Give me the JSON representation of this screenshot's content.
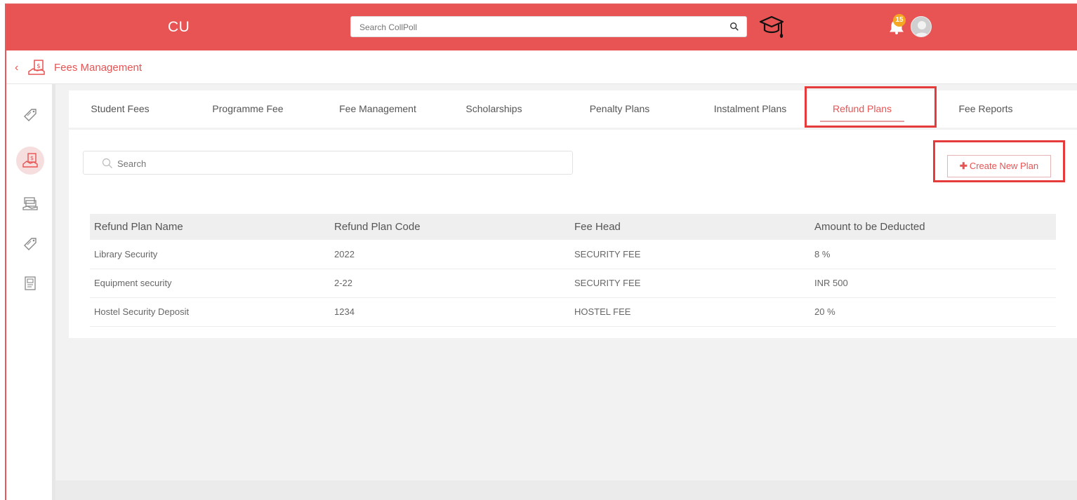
{
  "app": {
    "brand": "CU",
    "search_placeholder": "Search CollPoll",
    "notification_count": "15",
    "colors": {
      "primary": "#e85353",
      "highlight": "#e53b3b"
    }
  },
  "breadcrumb": {
    "title": "Fees Management"
  },
  "sidebar": {
    "items": [
      {
        "icon": "tag-icon"
      },
      {
        "icon": "fees-icon",
        "active": true
      },
      {
        "icon": "money-stack-icon"
      },
      {
        "icon": "tag-icon"
      },
      {
        "icon": "report-icon"
      }
    ]
  },
  "tabs": [
    {
      "label": "Student Fees"
    },
    {
      "label": "Programme Fee"
    },
    {
      "label": "Fee Management"
    },
    {
      "label": "Scholarships"
    },
    {
      "label": "Penalty Plans"
    },
    {
      "label": "Instalment Plans"
    },
    {
      "label": "Refund Plans",
      "active": true
    },
    {
      "label": "Fee Reports"
    }
  ],
  "main": {
    "search_placeholder": "Search",
    "create_button": "Create New Plan",
    "table": {
      "headers": [
        "Refund Plan Name",
        "Refund Plan Code",
        "Fee Head",
        "Amount to be Deducted"
      ],
      "rows": [
        [
          "Library Security",
          "2022",
          "SECURITY FEE",
          "8 %"
        ],
        [
          "Equipment security",
          "2-22",
          "SECURITY FEE",
          "INR 500"
        ],
        [
          "Hostel Security Deposit",
          "1234",
          "HOSTEL FEE",
          "20 %"
        ]
      ]
    }
  }
}
